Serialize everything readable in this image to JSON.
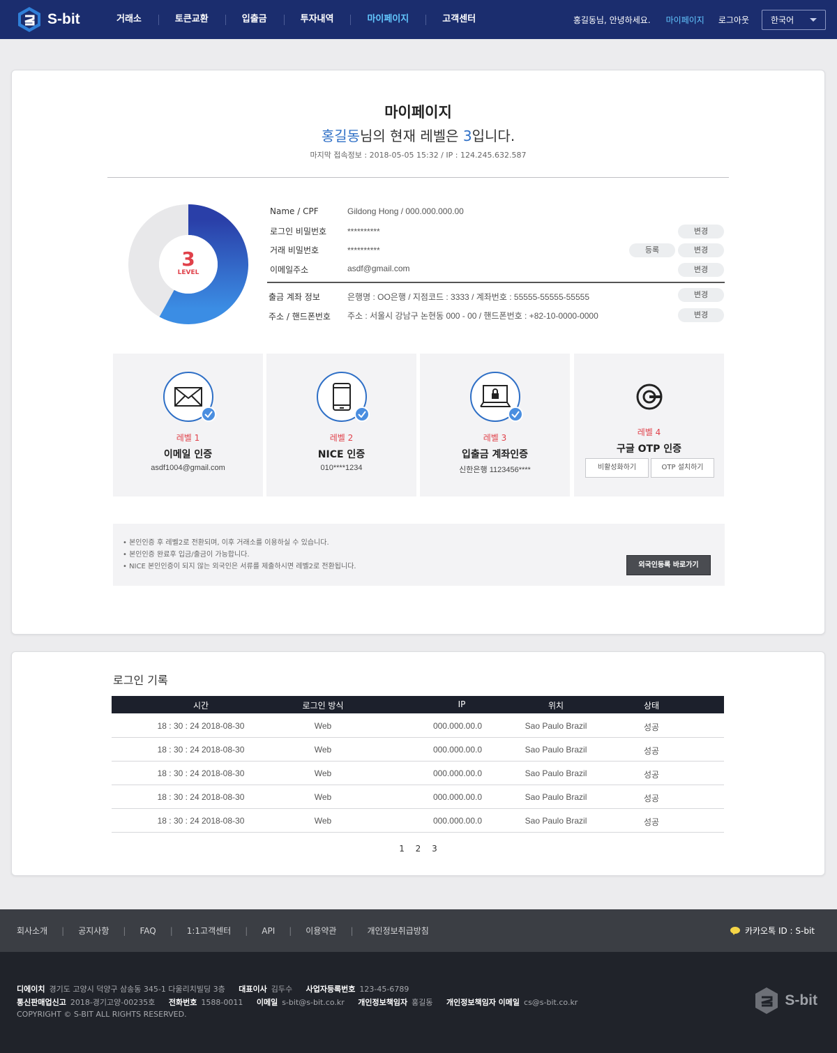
{
  "header": {
    "brand": "S-bit",
    "nav": [
      "거래소",
      "토큰교환",
      "입출금",
      "투자내역",
      "마이페이지",
      "고객센터"
    ],
    "greeting": "홍길동님, 안녕하세요.",
    "mypage_link": "마이페이지",
    "logout_link": "로그아웃",
    "language": "한국어",
    "colors": {
      "bar": "#1b2d6e",
      "active": "#63c7ff"
    }
  },
  "profile": {
    "title": "마이페이지",
    "user_name": "홍길동",
    "level_text_pre": "님의 현재 레벨은 ",
    "level": "3",
    "level_text_post": "입니다.",
    "last_access": "마지막 접속정보 : 2018-05-05 15:32  / IP : 124.245.632.587",
    "level_label": "LEVEL",
    "level_progress": 0.58,
    "rows": [
      {
        "label": "Name / CPF",
        "value": "Gildong Hong   /   000.000.000.00"
      },
      {
        "label": "로그인 비밀번호",
        "value": "**********",
        "button": "변경"
      },
      {
        "label": "거래 비밀번호",
        "value": "**********",
        "register": "등록",
        "button": "변경"
      },
      {
        "label": "이메일주소",
        "value": "asdf@gmail.com",
        "button": "변경"
      },
      {
        "label": "출금 계좌 정보",
        "value": "은행명 : OO은행    /    지점코드 : 3333    /    계좌번호 : 55555-55555-55555",
        "button": "변경"
      },
      {
        "label": "주소 / 핸드폰번호",
        "value": "주소 : 서울시 강남구 논현동 000 - 00    /    핸드폰번호 : +82-10-0000-0000",
        "button": "변경"
      }
    ]
  },
  "levels": [
    {
      "tag": "레벨 1",
      "name": "이메일 인증",
      "sub": "asdf1004@gmail.com",
      "icon": "envelope-icon"
    },
    {
      "tag": "레벨 2",
      "name": "NICE 인증",
      "sub": "010****1234",
      "icon": "smartphone-icon"
    },
    {
      "tag": "레벨 3",
      "name": "입출금 계좌인증",
      "sub": "신한은행 1123456****",
      "icon": "laptop-lock-icon"
    },
    {
      "tag": "레벨 4",
      "name": "구글 OTP 인증",
      "btn_disable": "비활성화하기",
      "btn_install": "OTP 설치하기",
      "icon": "google-otp-icon"
    }
  ],
  "notice": {
    "lines": [
      "• 본인인증 후 레벨2로 전환되며, 이후 거래소를 이용하실 수 있습니다.",
      "• 본인인증 완료후 입금/출금이 가능합니다.",
      "• NICE 본인인증이 되지 않는 외국인은 서류를 제출하시면 레벨2로 전환됩니다."
    ],
    "button": "외국인등록 바로가기"
  },
  "login_history": {
    "title": "로그인 기록",
    "columns": [
      "시간",
      "로그인 방식",
      "IP",
      "위치",
      "상태"
    ],
    "rows": [
      [
        "18 : 30 : 24   2018-08-30",
        "Web",
        "000.000.00.0",
        "Sao Paulo Brazil",
        "성공"
      ],
      [
        "18 : 30 : 24   2018-08-30",
        "Web",
        "000.000.00.0",
        "Sao Paulo Brazil",
        "성공"
      ],
      [
        "18 : 30 : 24   2018-08-30",
        "Web",
        "000.000.00.0",
        "Sao Paulo Brazil",
        "성공"
      ],
      [
        "18 : 30 : 24   2018-08-30",
        "Web",
        "000.000.00.0",
        "Sao Paulo Brazil",
        "성공"
      ],
      [
        "18 : 30 : 24   2018-08-30",
        "Web",
        "000.000.00.0",
        "Sao Paulo Brazil",
        "성공"
      ]
    ],
    "pages": [
      "1",
      "2",
      "3"
    ]
  },
  "footer": {
    "links": [
      "회사소개",
      "공지사항",
      "FAQ",
      "1:1고객센터",
      "API",
      "이용약관",
      "개인정보취급방침"
    ],
    "kakao": "카카오톡 ID : S-bit",
    "company_label": "디에이치",
    "address": "경기도 고양시 덕양구 삼송동 345-1 다울리치빌딩 3층",
    "ceo_label": "대표이사",
    "ceo": "김두수",
    "bizno_label": "사업자등록번호",
    "bizno": "123-45-6789",
    "mailorder_label": "통신판매업신고",
    "mailorder": "2018-경기고양-00235호",
    "phone_label": "전화번호",
    "phone": "1588-0011",
    "email_label": "이메일",
    "email": "s-bit@s-bit.co.kr",
    "privacy_label": "개인정보책임자",
    "privacy": "홍길동",
    "privacy_email_label": "개인정보책임자 이메일",
    "privacy_email": "cs@s-bit.co.kr",
    "copyright": "COPYRIGHT © S-BIT ALL RIGHTS RESERVED.",
    "brand": "S-bit"
  }
}
